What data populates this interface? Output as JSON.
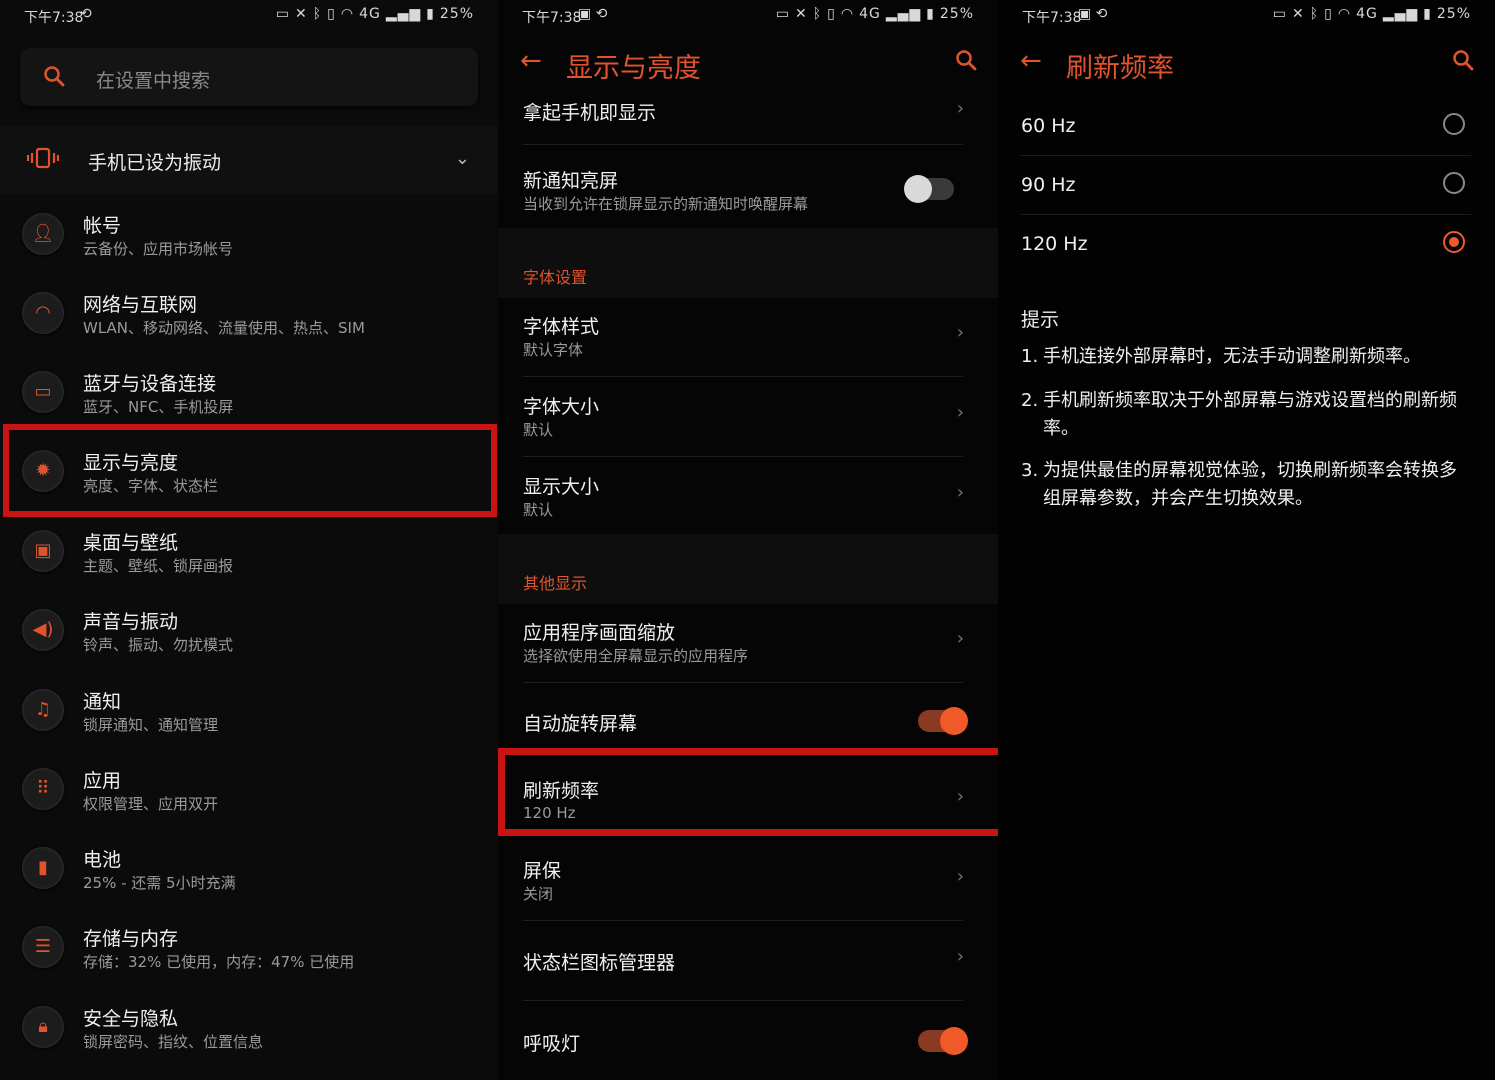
{
  "status": {
    "time": "下午7:38",
    "battery": "25%",
    "network": "4G",
    "icons": [
      "screenshot-icon",
      "sync-icon",
      "nfc-icon",
      "x-icon",
      "bluetooth-icon",
      "vibrate-icon",
      "wifi-icon",
      "signal-icon",
      "battery-icon"
    ]
  },
  "panel1": {
    "search_placeholder": "在设置中搜索",
    "vibrate_label": "手机已设为振动",
    "items": [
      {
        "title": "帐号",
        "sub": "云备份、应用市场帐号",
        "icon": "account-icon"
      },
      {
        "title": "网络与互联网",
        "sub": "WLAN、移动网络、流量使用、热点、SIM",
        "icon": "wifi-icon"
      },
      {
        "title": "蓝牙与设备连接",
        "sub": "蓝牙、NFC、手机投屏",
        "icon": "devices-icon"
      },
      {
        "title": "显示与亮度",
        "sub": "亮度、字体、状态栏",
        "icon": "brightness-icon"
      },
      {
        "title": "桌面与壁纸",
        "sub": "主题、壁纸、锁屏画报",
        "icon": "wallpaper-icon"
      },
      {
        "title": "声音与振动",
        "sub": "铃声、振动、勿扰模式",
        "icon": "sound-icon"
      },
      {
        "title": "通知",
        "sub": "锁屏通知、通知管理",
        "icon": "bell-icon"
      },
      {
        "title": "应用",
        "sub": "权限管理、应用双开",
        "icon": "apps-icon"
      },
      {
        "title": "电池",
        "sub": "25% - 还需 5小时充满",
        "icon": "battery-icon"
      },
      {
        "title": "存储与内存",
        "sub": "存储：32% 已使用，内存：47% 已使用",
        "icon": "storage-icon"
      },
      {
        "title": "安全与隐私",
        "sub": "锁屏密码、指纹、位置信息",
        "icon": "lock-icon"
      }
    ]
  },
  "panel2": {
    "title": "显示与亮度",
    "lift_to_wake": "拿起手机即显示",
    "new_notif_title": "新通知亮屏",
    "new_notif_sub": "当收到允许在锁屏显示的新通知时唤醒屏幕",
    "section_font": "字体设置",
    "font_style_title": "字体样式",
    "font_style_sub": "默认字体",
    "font_size_title": "字体大小",
    "font_size_sub": "默认",
    "display_size_title": "显示大小",
    "display_size_sub": "默认",
    "section_other": "其他显示",
    "app_scale_title": "应用程序画面缩放",
    "app_scale_sub": "选择欲使用全屏幕显示的应用程序",
    "auto_rotate": "自动旋转屏幕",
    "refresh_title": "刷新频率",
    "refresh_sub": "120 Hz",
    "screensaver_title": "屏保",
    "screensaver_sub": "关闭",
    "statusbar_icons": "状态栏图标管理器",
    "breathing_light": "呼吸灯",
    "toggles": {
      "new_notif": false,
      "auto_rotate": true,
      "breathing_light": true
    }
  },
  "panel3": {
    "title": "刷新频率",
    "options": [
      "60 Hz",
      "90 Hz",
      "120 Hz"
    ],
    "selected": "120 Hz",
    "tips_title": "提示",
    "tips": [
      {
        "num": "1.",
        "text": "手机连接外部屏幕时，无法手动调整刷新频率。"
      },
      {
        "num": "2.",
        "text": "手机刷新频率取决于外部屏幕与游戏设置档的刷新频率。"
      },
      {
        "num": "3.",
        "text": "为提供最佳的屏幕视觉体验，切换刷新频率会转换多组屏幕参数，并会产生切换效果。"
      }
    ]
  },
  "colors": {
    "accent": "#e0532c",
    "highlight_box": "#c81414",
    "background": "#000000"
  }
}
